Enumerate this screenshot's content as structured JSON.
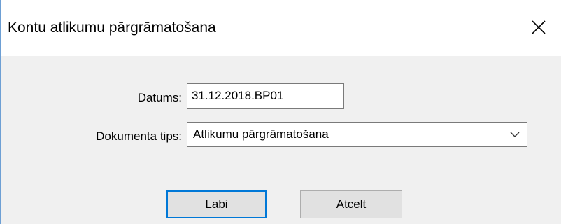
{
  "dialog": {
    "title": "Kontu atlikumu pārgrāmatošana",
    "close_icon": "close-icon"
  },
  "form": {
    "date_label": "Datums:",
    "date_value": "31.12.2018.BP01",
    "doc_type_label": "Dokumenta tips:",
    "doc_type_value": "Atlikumu pārgrāmatošana",
    "doc_type_icon": "chevron-down-icon"
  },
  "buttons": {
    "ok_label": "Labi",
    "cancel_label": "Atcelt"
  }
}
